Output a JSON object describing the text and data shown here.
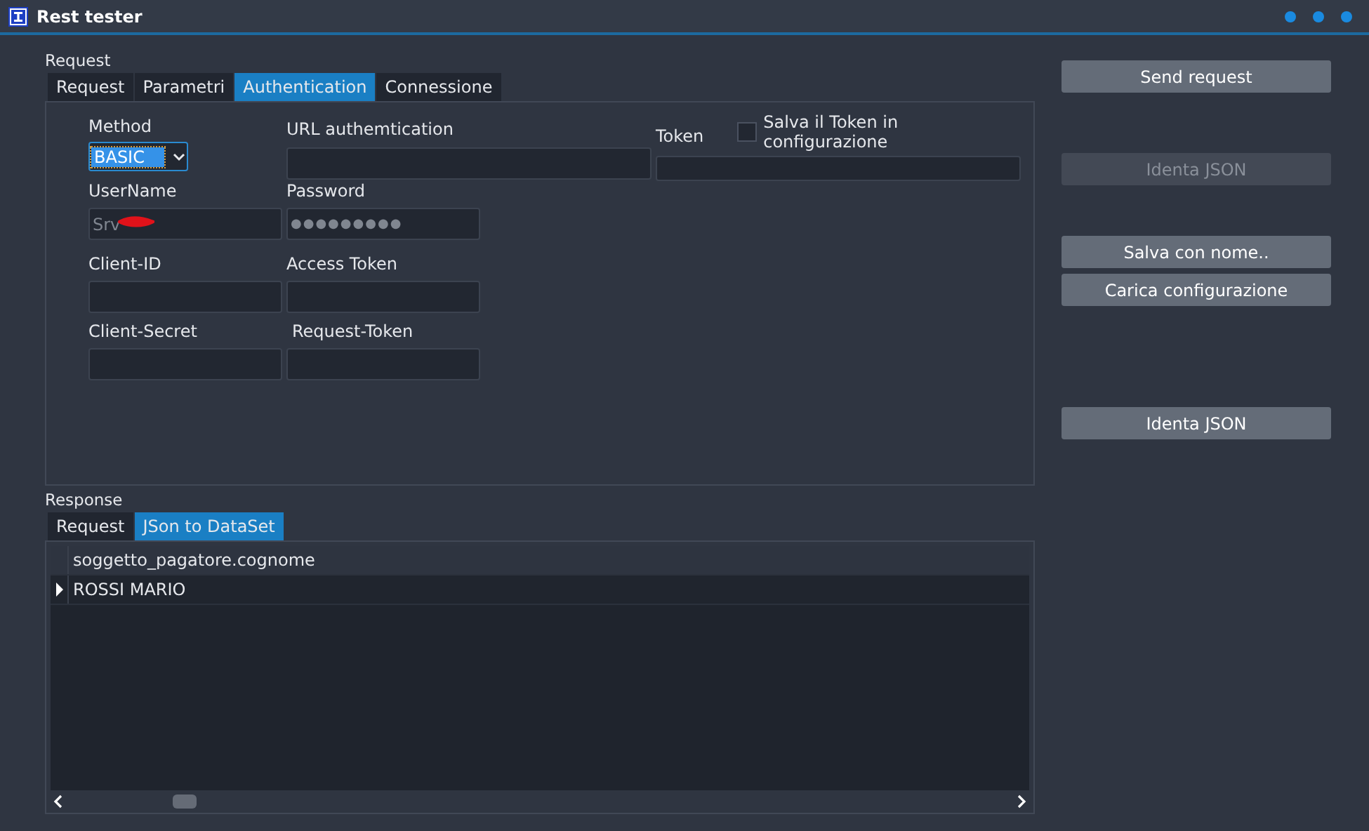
{
  "window": {
    "title": "Rest tester"
  },
  "request": {
    "label": "Request",
    "tabs": [
      {
        "label": "Request",
        "selected": false
      },
      {
        "label": "Parametri",
        "selected": false
      },
      {
        "label": "Authentication",
        "selected": true
      },
      {
        "label": "Connessione",
        "selected": false
      }
    ],
    "method": {
      "label": "Method",
      "value": "BASIC"
    },
    "url_authentication": {
      "label": "URL authemtication"
    },
    "token": {
      "label": "Token"
    },
    "save_token": {
      "label": "Salva il Token in configurazione",
      "checked": false
    },
    "username": {
      "label": "UserName",
      "value": "Srv"
    },
    "password": {
      "label": "Password",
      "value": "●●●●●●●●●"
    },
    "client_id": {
      "label": "Client-ID"
    },
    "access_token": {
      "label": "Access Token"
    },
    "client_secret": {
      "label": "Client-Secret"
    },
    "request_token": {
      "label": "Request-Token"
    }
  },
  "response": {
    "label": "Response",
    "tabs": [
      {
        "label": "Request",
        "selected": false
      },
      {
        "label": "JSon to DataSet",
        "selected": true
      }
    ],
    "table": {
      "columns": [
        "soggetto_pagatore.cognome"
      ],
      "rows": [
        {
          "cells": [
            "ROSSI MARIO"
          ],
          "current": true
        }
      ]
    }
  },
  "buttons": [
    {
      "label": "Send request",
      "disabled": false
    },
    {
      "label": "Identa JSON",
      "disabled": true
    },
    {
      "label": "Salva con nome..",
      "disabled": false
    },
    {
      "label": "Carica configurazione",
      "disabled": false
    },
    {
      "label": "Identa JSON",
      "disabled": false
    }
  ]
}
